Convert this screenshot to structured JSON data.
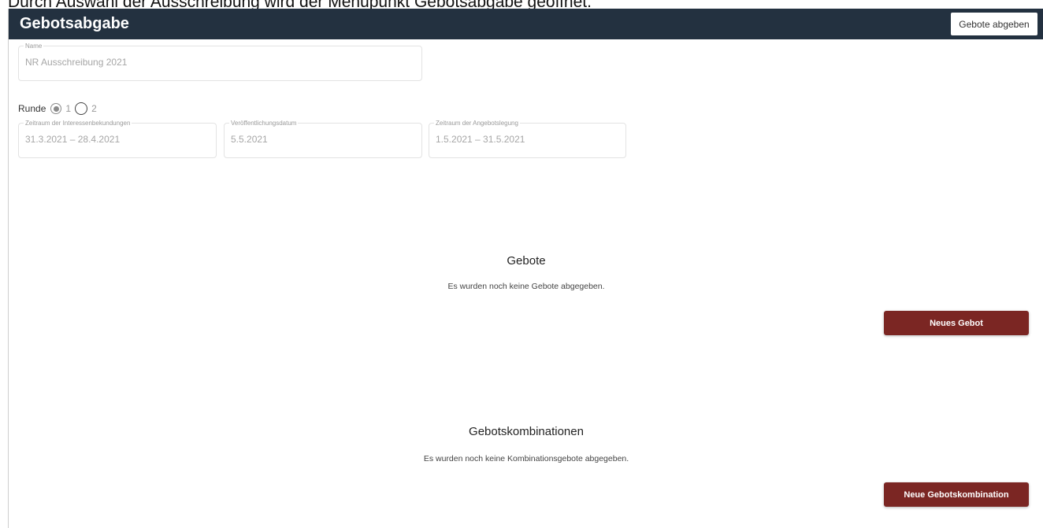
{
  "caption": "Durch Auswahl der Ausschreibung wird der Menüpunkt Gebotsabgabe geöffnet.",
  "header": {
    "title": "Gebotsabgabe",
    "submit_button": "Gebote abgeben"
  },
  "name_field": {
    "label": "Name",
    "value": "NR Ausschreibung 2021"
  },
  "round": {
    "label": "Runde",
    "options": [
      "1",
      "2"
    ],
    "selected": "1"
  },
  "date_fields": [
    {
      "label": "Zeitraum der Interessenbekundungen",
      "value": "31.3.2021 – 28.4.2021"
    },
    {
      "label": "Veröffentlichungsdatum",
      "value": "5.5.2021"
    },
    {
      "label": "Zeitraum der Angebotslegung",
      "value": "1.5.2021 – 31.5.2021"
    }
  ],
  "bids": {
    "title": "Gebote",
    "empty_text": "Es wurden noch keine Gebote abgegeben.",
    "button": "Neues Gebot"
  },
  "combinations": {
    "title": "Gebotskombinationen",
    "empty_text": "Es wurden noch keine Kombinationsgebote abgegeben.",
    "button": "Neue Gebotskombination"
  },
  "colors": {
    "topbar": "#233140",
    "accent_button": "#7b2623"
  }
}
